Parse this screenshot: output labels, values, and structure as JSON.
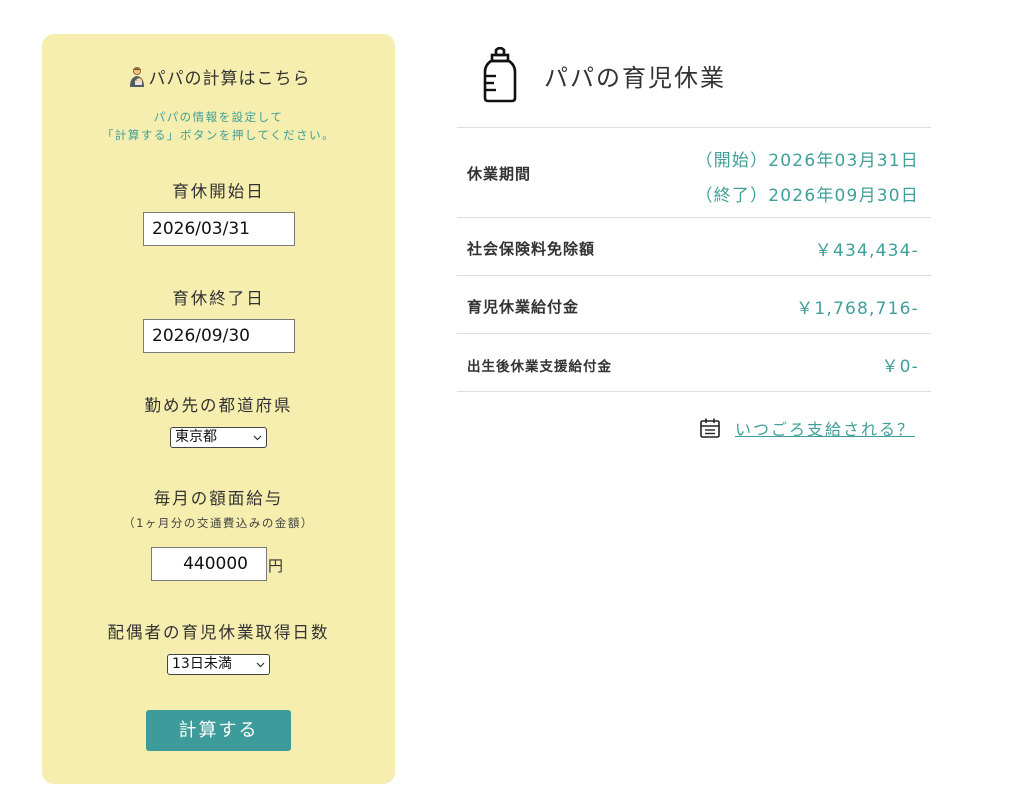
{
  "form": {
    "title": "パパの計算はこちら",
    "hint_line1": "パパの情報を設定して",
    "hint_line2": "「計算する」ボタンを押してください。",
    "start_label": "育休開始日",
    "start_value": "2026/03/31",
    "end_label": "育休終了日",
    "end_value": "2026/09/30",
    "prefecture_label": "勤め先の都道府県",
    "prefecture_value": "東京都",
    "salary_label": "毎月の額面給与",
    "salary_note": "（1ヶ月分の交通費込みの金額）",
    "salary_value": "440000",
    "salary_unit": "円",
    "spouse_label": "配偶者の育児休業取得日数",
    "spouse_value": "13日未満",
    "calc_button": "計算する"
  },
  "result": {
    "title": "パパの育児休業",
    "period_label": "休業期間",
    "period_start": "（開始）2026年03月31日",
    "period_end": "（終了）2026年09月30日",
    "insurance_label": "社会保険料免除額",
    "insurance_value": "￥434,434-",
    "benefit_label": "育児休業給付金",
    "benefit_value": "￥1,768,716-",
    "postbirth_label": "出生後休業支援給付金",
    "postbirth_value": "￥0-",
    "schedule_link": "いつごろ支給される？"
  },
  "colors": {
    "panel_bg": "#f5eeae",
    "accent": "#3f9f9a",
    "button_bg": "#3e9b9b",
    "divider": "#dddddd"
  },
  "icons": {
    "title_icon": "father-baby-icon",
    "result_icon": "baby-bottle-icon",
    "link_icon": "calendar-icon",
    "dropdown_icon": "chevron-down-icon"
  }
}
